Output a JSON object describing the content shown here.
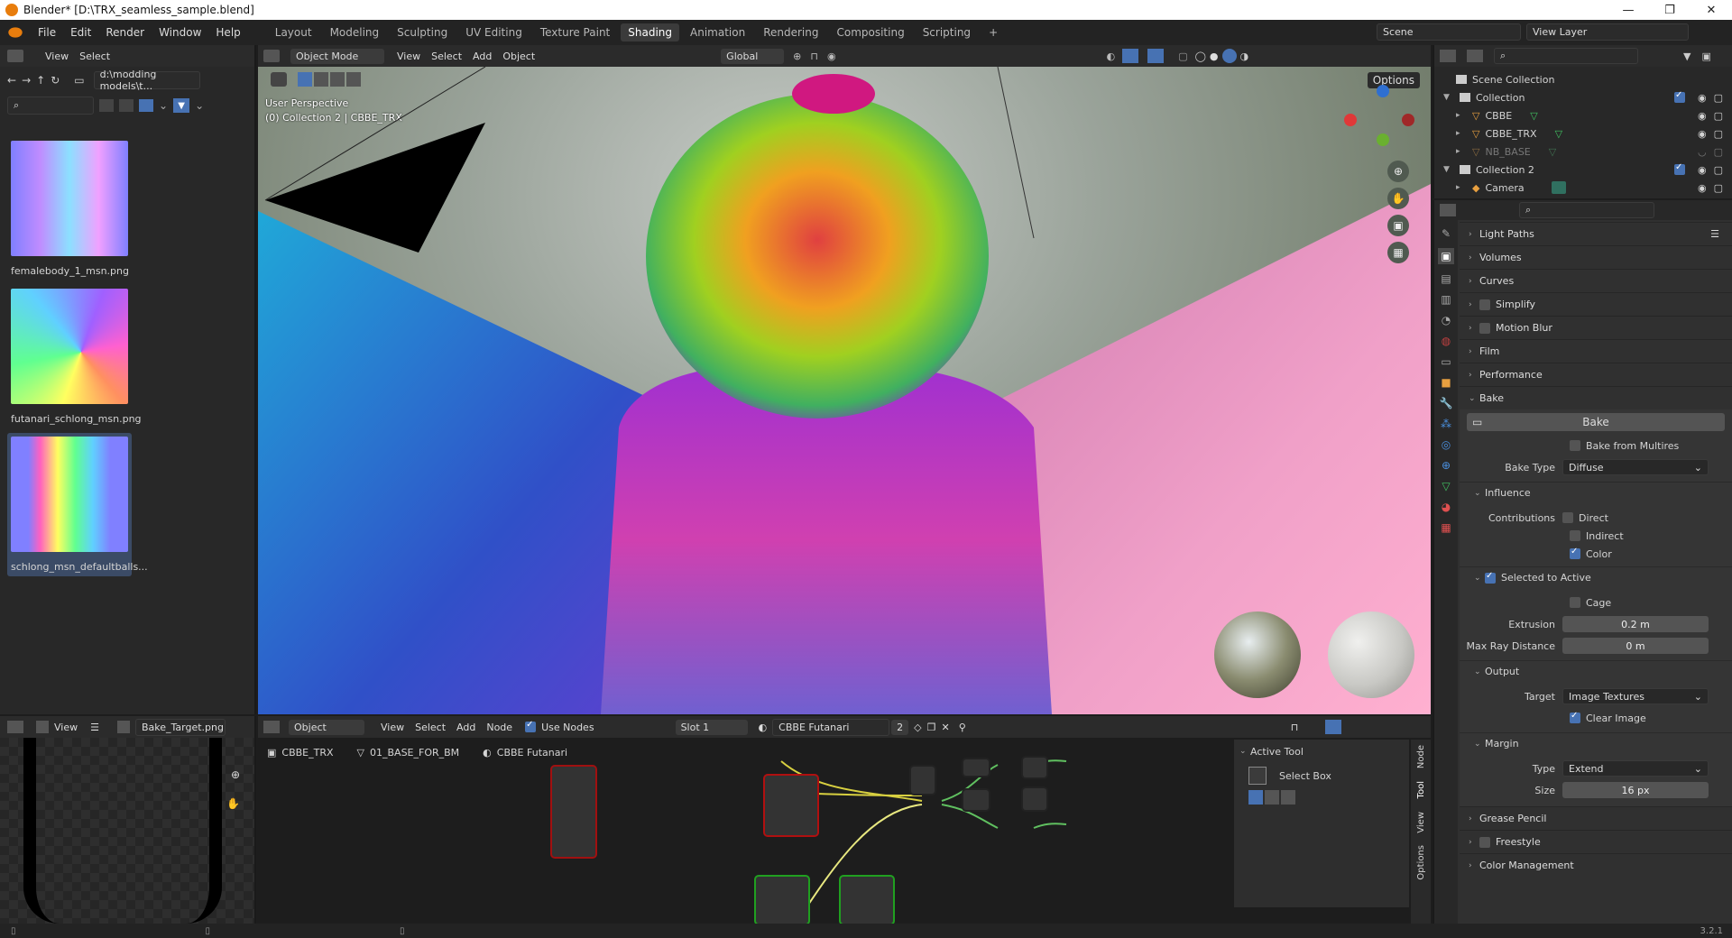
{
  "window": {
    "title": "Blender* [D:\\TRX_seamless_sample.blend]",
    "minimize": "—",
    "restore": "❐",
    "close": "✕"
  },
  "menu": [
    "File",
    "Edit",
    "Render",
    "Window",
    "Help"
  ],
  "workspaces": [
    "Layout",
    "Modeling",
    "Sculpting",
    "UV Editing",
    "Texture Paint",
    "Shading",
    "Animation",
    "Rendering",
    "Compositing",
    "Scripting",
    "+"
  ],
  "active_workspace": "Shading",
  "scene": {
    "label": "Scene",
    "view_layer": "View Layer"
  },
  "file_browser": {
    "menu": [
      "View",
      "Select"
    ],
    "path": "d:\\modding models\\t...",
    "thumbnails": [
      {
        "name": "femalebody_1_msn.png"
      },
      {
        "name": "futanari_schlong_msn.png"
      },
      {
        "name": "schlong_msn_defaultballs..."
      }
    ]
  },
  "viewport": {
    "mode": "Object Mode",
    "menu": [
      "View",
      "Select",
      "Add",
      "Object"
    ],
    "orientation": "Global",
    "options": "Options",
    "overlay_line1": "User Perspective",
    "overlay_line2": "(0) Collection 2 | CBBE_TRX"
  },
  "outliner": {
    "scene_collection": "Scene Collection",
    "items": [
      {
        "name": "Collection",
        "level": 0
      },
      {
        "name": "CBBE",
        "level": 1
      },
      {
        "name": "CBBE_TRX",
        "level": 1
      },
      {
        "name": "NB_BASE",
        "level": 1
      },
      {
        "name": "Collection 2",
        "level": 0
      },
      {
        "name": "Camera",
        "level": 1
      }
    ]
  },
  "properties": {
    "collapsed_top": [
      "Light Paths",
      "Volumes",
      "Curves",
      "Simplify",
      "Motion Blur",
      "Film",
      "Performance"
    ],
    "bake": {
      "section": "Bake",
      "button": "Bake",
      "from_multires": "Bake from Multires",
      "bake_type_label": "Bake Type",
      "bake_type": "Diffuse",
      "influence": "Influence",
      "contributions_label": "Contributions",
      "direct": "Direct",
      "indirect": "Indirect",
      "color": "Color",
      "selected_to_active": "Selected to Active",
      "cage": "Cage",
      "extrusion_label": "Extrusion",
      "extrusion": "0.2 m",
      "max_ray_label": "Max Ray Distance",
      "max_ray": "0 m",
      "output": "Output",
      "target_label": "Target",
      "target": "Image Textures",
      "clear_image": "Clear Image",
      "margin": "Margin",
      "type_label": "Type",
      "type": "Extend",
      "size_label": "Size",
      "size": "16 px"
    },
    "collapsed_bottom": [
      "Grease Pencil",
      "Freestyle",
      "Color Management"
    ]
  },
  "image_editor": {
    "view": "View",
    "image": "Bake_Target.png"
  },
  "node_editor": {
    "type": "Object",
    "menu": [
      "View",
      "Select",
      "Add",
      "Node"
    ],
    "use_nodes": "Use Nodes",
    "slot": "Slot 1",
    "material": "CBBE Futanari",
    "users": "2",
    "breadcrumb": [
      "CBBE_TRX",
      "01_BASE_FOR_BM",
      "CBBE Futanari"
    ]
  },
  "tool_panel": {
    "title": "Active Tool",
    "tool": "Select Box",
    "tabs": [
      "Node",
      "Tool",
      "View",
      "Options"
    ]
  },
  "version": "3.2.1"
}
